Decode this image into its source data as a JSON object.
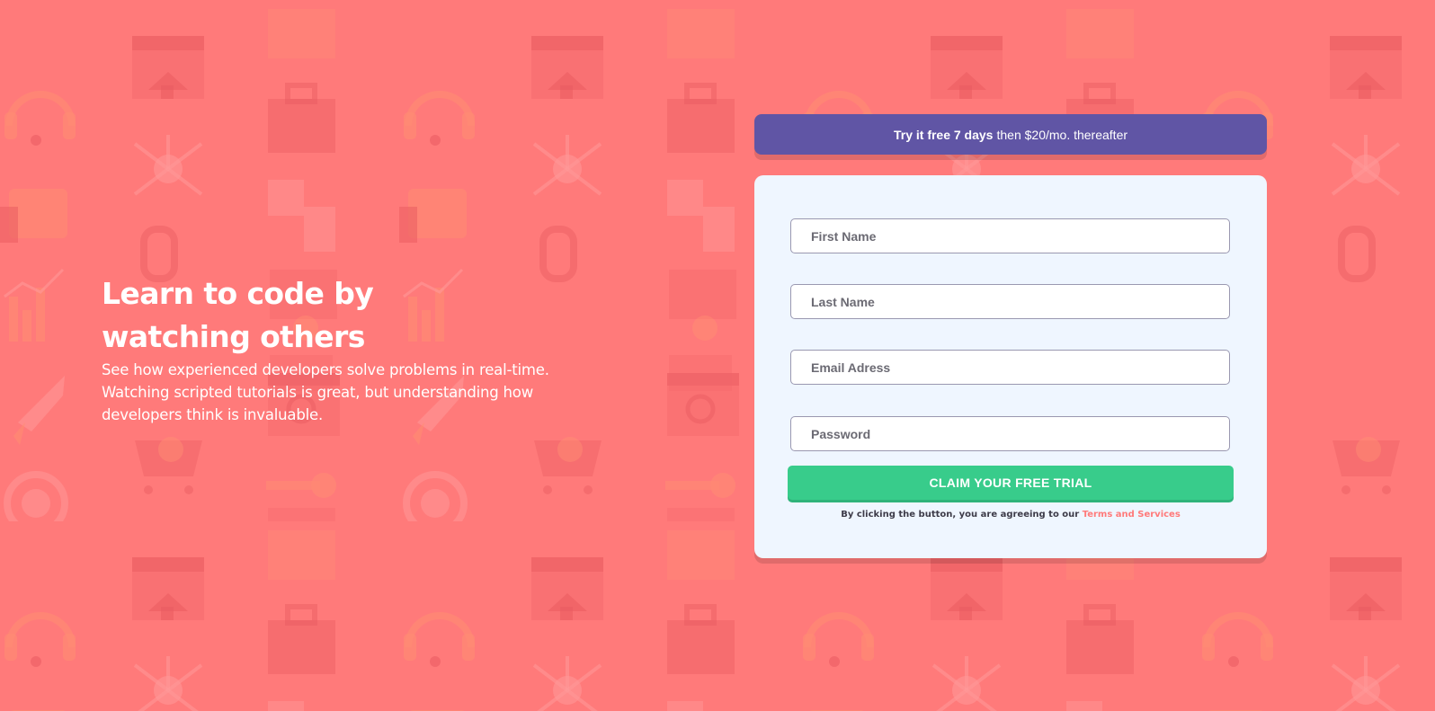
{
  "colors": {
    "background": "#ff7a7a",
    "promo": "#6055a5",
    "card": "#eff6ff",
    "button": "#38cc8b",
    "link": "#ff7a7a",
    "text_dark": "#3d3b48"
  },
  "hero": {
    "title_line1": "Learn to code by",
    "title_line2": "watching others",
    "body_line1": "See how experienced developers solve problems in real-time.",
    "body_line2": "Watching scripted tutorials is great, but understanding how",
    "body_line3": "developers think is invaluable."
  },
  "promo": {
    "strong": "Try it free 7 days",
    "rest": "then $20/mo. thereafter"
  },
  "form": {
    "first_name": {
      "value": "",
      "placeholder": "First Name"
    },
    "last_name": {
      "value": "",
      "placeholder": "Last Name"
    },
    "email": {
      "value": "",
      "placeholder": "Email Adress"
    },
    "password": {
      "value": "",
      "placeholder": "Password"
    },
    "submit_label": "CLAIM YOUR FREE TRIAL",
    "terms_text": "By clicking the button, you are agreeing to our ",
    "terms_link": "Terms and Services"
  },
  "background_icons": [
    "browser-house-icon",
    "toolbox-icon",
    "headset-icon",
    "network-icon",
    "thumbs-up-icon",
    "chain-link-icon",
    "bar-chart-icon",
    "rocket-icon",
    "globe-gear-icon",
    "lifebuoy-icon",
    "calendar-icon",
    "lightbulb-icon",
    "shopping-cart-icon",
    "magnifier-icon",
    "cloud-icon"
  ]
}
